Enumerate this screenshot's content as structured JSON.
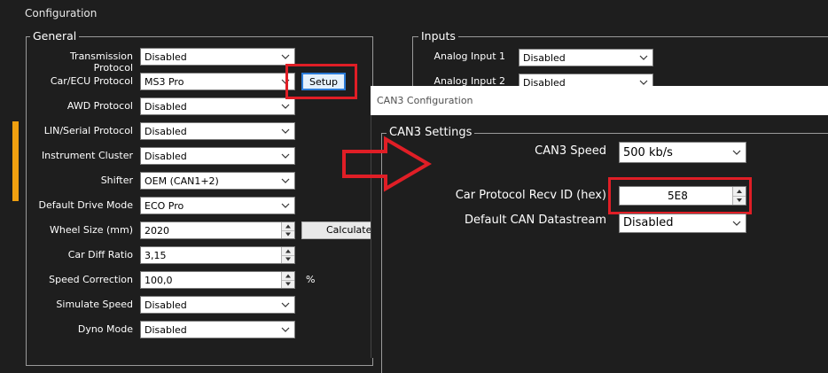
{
  "app": {
    "title": "Configuration"
  },
  "general": {
    "title": "General",
    "rows": [
      {
        "label": "Transmission Protocol",
        "value": "Disabled"
      },
      {
        "label": "Car/ECU Protocol",
        "value": "MS3 Pro"
      },
      {
        "label": "AWD Protocol",
        "value": "Disabled"
      },
      {
        "label": "LIN/Serial Protocol",
        "value": "Disabled"
      },
      {
        "label": "Instrument Cluster",
        "value": "Disabled"
      },
      {
        "label": "Shifter",
        "value": "OEM (CAN1+2)"
      },
      {
        "label": "Default Drive Mode",
        "value": "ECO Pro"
      },
      {
        "label": "Wheel Size (mm)",
        "value": "2020"
      },
      {
        "label": "Car Diff Ratio",
        "value": "3,15"
      },
      {
        "label": "Speed Correction",
        "value": "100,0"
      },
      {
        "label": "Simulate Speed",
        "value": "Disabled"
      },
      {
        "label": "Dyno Mode",
        "value": "Disabled"
      }
    ],
    "setup_label": "Setup",
    "calculate_label": "Calculate",
    "percent_unit": "%"
  },
  "inputs": {
    "title": "Inputs",
    "rows": [
      {
        "label": "Analog Input 1",
        "value": "Disabled"
      },
      {
        "label": "Analog Input 2",
        "value": "Disabled"
      }
    ]
  },
  "dialog": {
    "title": "CAN3 Configuration",
    "group_title": "CAN3 Settings",
    "speed_label": "CAN3 Speed",
    "speed_value": "500 kb/s",
    "recv_id_label": "Car Protocol Recv ID (hex)",
    "recv_id_value": "5E8",
    "datastream_label": "Default CAN Datastream",
    "datastream_value": "Disabled"
  },
  "colors": {
    "annotation_red": "#e01e26",
    "accent_orange": "#f0a010",
    "background": "#1e1e1e"
  }
}
